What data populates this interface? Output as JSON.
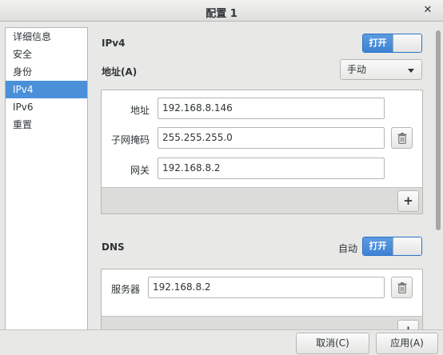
{
  "window": {
    "title": "配置 1",
    "close_glyph": "✕"
  },
  "sidebar": {
    "items": [
      {
        "label": "详细信息"
      },
      {
        "label": "安全"
      },
      {
        "label": "身份"
      },
      {
        "label": "IPv4"
      },
      {
        "label": "IPv6"
      },
      {
        "label": "重置"
      }
    ],
    "selected": "IPv4"
  },
  "ipv4": {
    "heading": "IPv4",
    "toggle_label": "打开",
    "address_heading": "地址(A)",
    "method_value": "手动",
    "fields": {
      "address_label": "地址",
      "address_value": "192.168.8.146",
      "netmask_label": "子网掩码",
      "netmask_value": "255.255.255.0",
      "gateway_label": "网关",
      "gateway_value": "192.168.8.2"
    },
    "add_glyph": "+"
  },
  "dns": {
    "heading": "DNS",
    "auto_label": "自动",
    "toggle_label": "打开",
    "server_label": "服务器",
    "server_value": "192.168.8.2",
    "add_glyph": "+"
  },
  "buttons": {
    "cancel_label": "取消(C)",
    "apply_label": "应用(A)"
  },
  "colors": {
    "accent": "#4a90d9",
    "window_bg": "#e8e8e7",
    "panel_bg": "#ffffff"
  },
  "icons": {
    "delete": "trash-icon",
    "add": "plus-icon",
    "close": "close-icon",
    "dropdown": "chevron-down-icon"
  }
}
